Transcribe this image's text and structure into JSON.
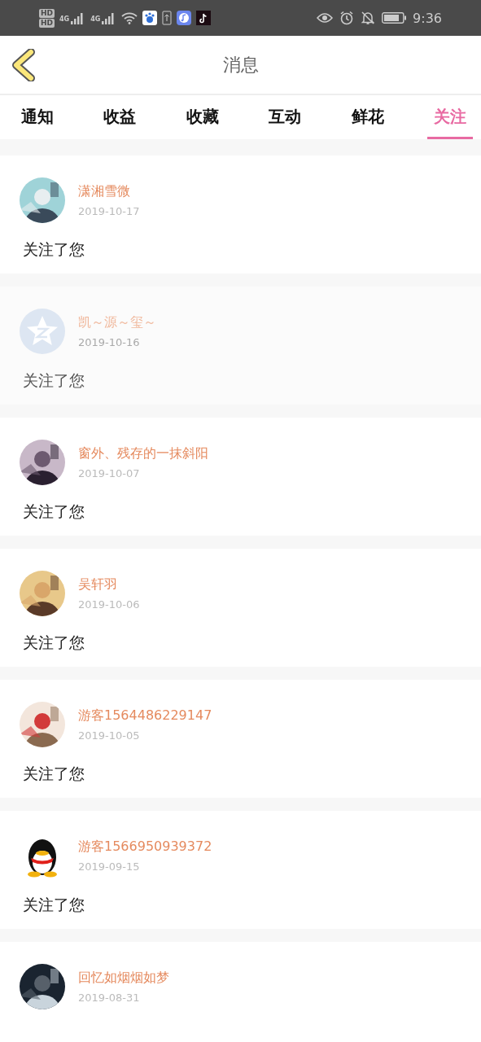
{
  "status_bar": {
    "sim_labels": [
      "HD",
      "HD"
    ],
    "network": [
      "4G",
      "4G"
    ],
    "time": "9:36"
  },
  "header": {
    "title": "消息"
  },
  "tabs": [
    {
      "label": "通知",
      "selected": false
    },
    {
      "label": "收益",
      "selected": false
    },
    {
      "label": "收藏",
      "selected": false
    },
    {
      "label": "互动",
      "selected": false
    },
    {
      "label": "鲜花",
      "selected": false
    },
    {
      "label": "关注",
      "selected": true
    }
  ],
  "messages": [
    {
      "name": "潇湘雪微",
      "date": "2019-10-17",
      "text": "关注了您",
      "highlighted": false
    },
    {
      "name": "凯～源～玺～",
      "date": "2019-10-16",
      "text": "关注了您",
      "avatar": {
        "kind": "star"
      },
      "highlighted": true
    },
    {
      "name": "窗外、残存的一抹斜阳",
      "date": "2019-10-07",
      "text": "关注了您",
      "highlighted": false
    },
    {
      "name": "吴轩羽",
      "date": "2019-10-06",
      "text": "关注了您",
      "highlighted": false
    },
    {
      "name": "游客1564486229147",
      "date": "2019-10-05",
      "text": "关注了您",
      "highlighted": false
    },
    {
      "name": "游客1566950939372",
      "date": "2019-09-15",
      "text": "关注了您",
      "avatar": {
        "kind": "penguin"
      },
      "highlighted": false
    },
    {
      "name": "回忆如烟烟如梦",
      "date": "2019-08-31",
      "highlighted": false
    }
  ]
}
